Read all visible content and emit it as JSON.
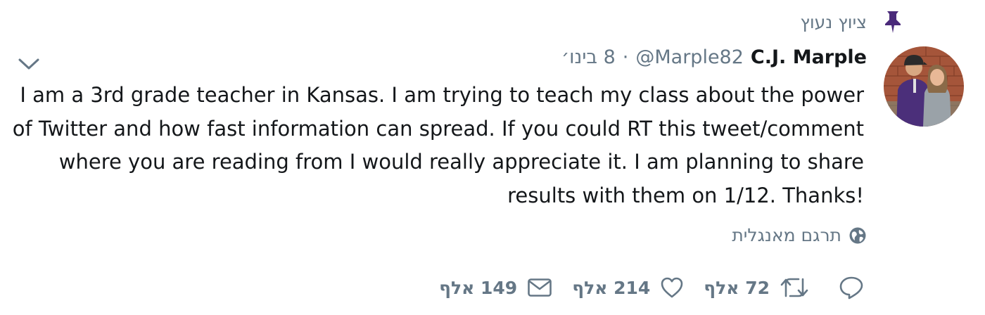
{
  "pinned": {
    "label": "ציוץ נעוץ",
    "icon": "pin-icon",
    "icon_color": "#4a2a7a"
  },
  "tweet": {
    "display_name": "C.J. Marple",
    "handle": "@Marple82",
    "separator": "·",
    "date": "8 בינו׳",
    "text": "I am a 3rd grade teacher in Kansas. I am trying to teach my class about the power of Twitter and how fast information can spread. If you could RT this tweet/comment where you are reading from I would really appreciate it. I am planning to share results with them on 1/12. Thanks!",
    "translate_label": "תרגם מאנגלית",
    "menu_icon": "chevron-down-icon"
  },
  "actions": {
    "reply": {
      "icon": "reply-icon",
      "count": ""
    },
    "retweet": {
      "icon": "retweet-icon",
      "count": "72 אלף"
    },
    "like": {
      "icon": "heart-icon",
      "count": "214 אלף"
    },
    "message": {
      "icon": "envelope-icon",
      "count": "149 אלף"
    }
  },
  "colors": {
    "text_primary": "#14171a",
    "text_secondary": "#657786"
  }
}
